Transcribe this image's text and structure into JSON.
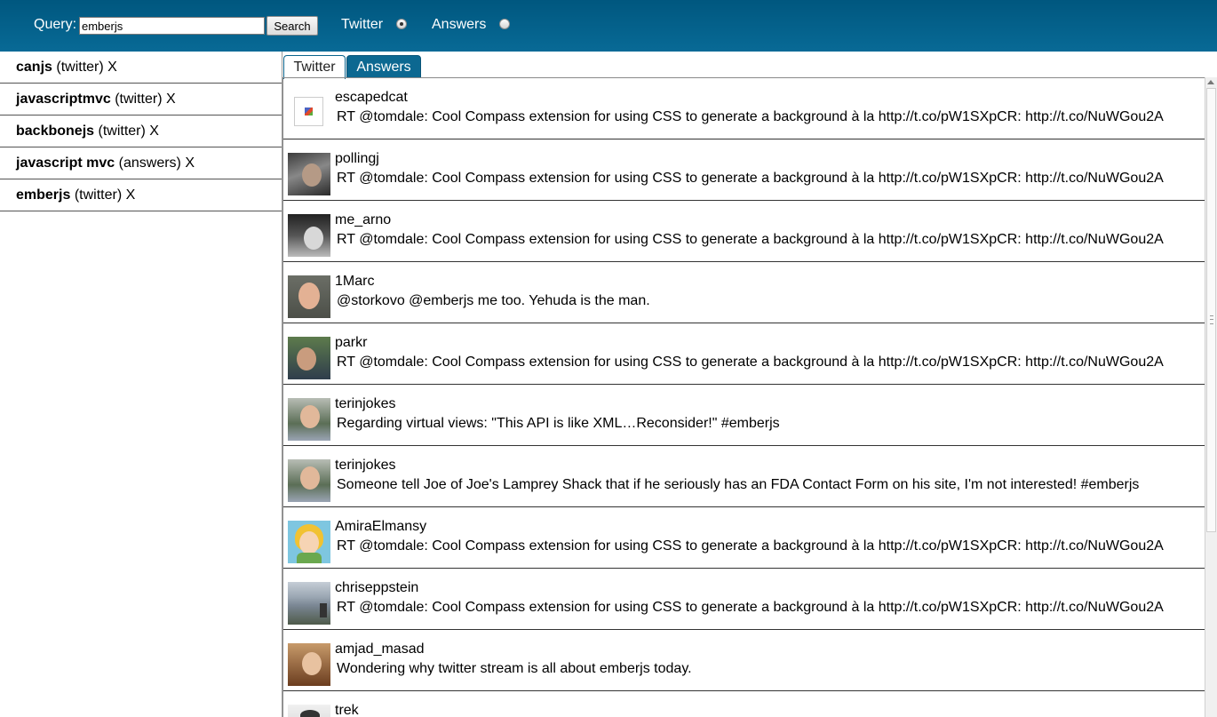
{
  "search": {
    "label": "Query:",
    "value": "emberjs",
    "button": "Search",
    "sources": [
      {
        "label": "Twitter",
        "checked": true
      },
      {
        "label": "Answers",
        "checked": false
      }
    ]
  },
  "history": [
    {
      "term": "canjs",
      "source": "(twitter)",
      "remove": "X"
    },
    {
      "term": "javascriptmvc",
      "source": "(twitter)",
      "remove": "X"
    },
    {
      "term": "backbonejs",
      "source": "(twitter)",
      "remove": "X"
    },
    {
      "term": "javascript mvc",
      "source": "(answers)",
      "remove": "X"
    },
    {
      "term": "emberjs",
      "source": "(twitter)",
      "remove": "X"
    }
  ],
  "tabs": [
    {
      "label": "Twitter",
      "active": true
    },
    {
      "label": "Answers",
      "active": false
    }
  ],
  "tweets": [
    {
      "user": "escapedcat",
      "text": "RT @tomdale: Cool Compass extension for using CSS to generate a background à la http://t.co/pW1SXpCR: http://t.co/NuWGou2A"
    },
    {
      "user": "pollingj",
      "text": "RT @tomdale: Cool Compass extension for using CSS to generate a background à la http://t.co/pW1SXpCR: http://t.co/NuWGou2A"
    },
    {
      "user": "me_arno",
      "text": "RT @tomdale: Cool Compass extension for using CSS to generate a background à la http://t.co/pW1SXpCR: http://t.co/NuWGou2A"
    },
    {
      "user": "1Marc",
      "text": "@storkovo @emberjs me too. Yehuda is the man."
    },
    {
      "user": "parkr",
      "text": "RT @tomdale: Cool Compass extension for using CSS to generate a background à la http://t.co/pW1SXpCR: http://t.co/NuWGou2A"
    },
    {
      "user": "terinjokes",
      "text": "Regarding virtual views: \"This API is like XML…Reconsider!\" #emberjs"
    },
    {
      "user": "terinjokes",
      "text": "Someone tell Joe of Joe's Lamprey Shack that if he seriously has an FDA Contact Form on his site, I'm not interested! #emberjs"
    },
    {
      "user": "AmiraElmansy",
      "text": "RT @tomdale: Cool Compass extension for using CSS to generate a background à la http://t.co/pW1SXpCR: http://t.co/NuWGou2A"
    },
    {
      "user": "chriseppstein",
      "text": "RT @tomdale: Cool Compass extension for using CSS to generate a background à la http://t.co/pW1SXpCR: http://t.co/NuWGou2A"
    },
    {
      "user": "amjad_masad",
      "text": "Wondering why twitter stream is all about emberjs today."
    },
    {
      "user": "trek",
      "text": ""
    }
  ],
  "colors": {
    "header": "#086a96",
    "tab_active_border": "#0b648d",
    "tab_inactive": "#0c6891"
  }
}
